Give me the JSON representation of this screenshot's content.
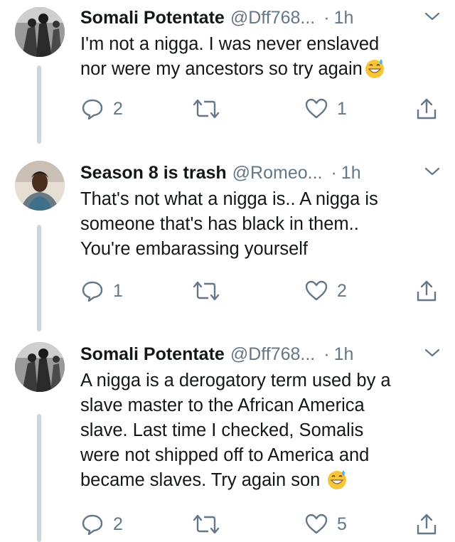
{
  "tweets": [
    {
      "display_name": "Somali Potentate",
      "handle": "@Dff768...",
      "dot": "·",
      "time": "1h",
      "text_lines": [
        "I'm not a nigga. I was never enslaved",
        "nor were my ancestors so try again"
      ],
      "emoji": "sweat-smile-emoji",
      "avatar": "bw-avatar",
      "replies": "2",
      "retweets": "",
      "likes": "1"
    },
    {
      "display_name": "Season 8 is trash",
      "handle": "@Romeo...",
      "dot": "·",
      "time": "1h",
      "text_lines": [
        "That's not what a nigga is.. A nigga is",
        "someone that's has black in them..",
        "You're embarassing yourself"
      ],
      "avatar": "color-avatar",
      "replies": "1",
      "retweets": "",
      "likes": "2"
    },
    {
      "display_name": "Somali Potentate",
      "handle": "@Dff768...",
      "dot": "·",
      "time": "1h",
      "text_lines": [
        "A nigga is a derogatory term used by a",
        "slave master to the African America",
        "slave. Last time I checked, Somalis",
        "were not shipped off to America and",
        "became slaves. Try again son"
      ],
      "emoji": "sweat-smile-emoji",
      "avatar": "bw-avatar",
      "replies": "2",
      "retweets": "",
      "likes": "5"
    }
  ],
  "colors": {
    "text": "#14171a",
    "secondary": "#657786",
    "thread_line": "#ccd6dd"
  }
}
